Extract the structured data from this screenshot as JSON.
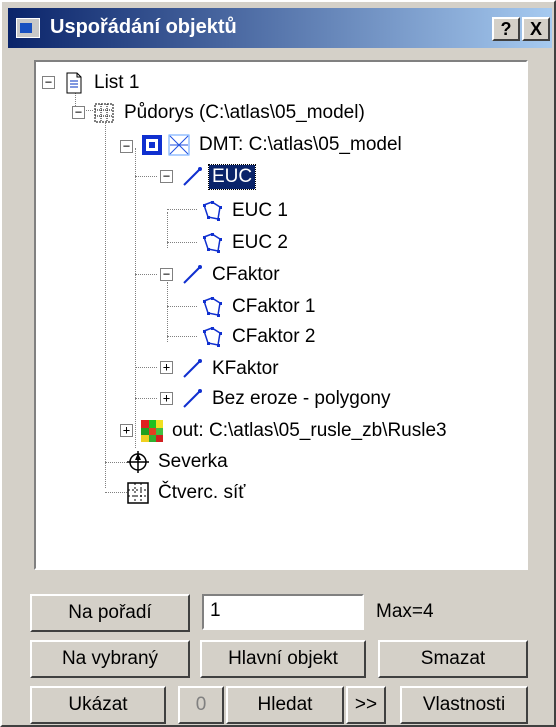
{
  "window": {
    "title": "Uspořádání objektů",
    "help_label": "?",
    "close_label": "X"
  },
  "tree": {
    "nodes": [
      {
        "label": "List 1",
        "icon": "document-icon",
        "expander": "−"
      },
      {
        "label": "Půdorys (C:\\atlas\\05_model)",
        "icon": "grid-layout-icon",
        "expander": "−"
      },
      {
        "label": "DMT: C:\\atlas\\05_model",
        "icon": "dmt-icon",
        "expander": "−"
      },
      {
        "label": "EUC",
        "icon": "line-icon",
        "expander": "−",
        "selected": true
      },
      {
        "label": "EUC 1",
        "icon": "polygon-icon"
      },
      {
        "label": "EUC 2",
        "icon": "polygon-icon"
      },
      {
        "label": "CFaktor",
        "icon": "line-icon",
        "expander": "−"
      },
      {
        "label": "CFaktor 1",
        "icon": "polygon-icon"
      },
      {
        "label": "CFaktor 2",
        "icon": "polygon-icon"
      },
      {
        "label": "KFaktor",
        "icon": "line-icon",
        "expander": "+"
      },
      {
        "label": "Bez eroze - polygony",
        "icon": "line-icon",
        "expander": "+"
      },
      {
        "label": "out: C:\\atlas\\05_rusle_zb\\Rusle3",
        "icon": "raster-icon",
        "expander": "+"
      },
      {
        "label": "Severka",
        "icon": "north-arrow-icon"
      },
      {
        "label": "Čtverc. síť",
        "icon": "grid-icon"
      }
    ]
  },
  "controls": {
    "na_poradi_label": "Na pořadí",
    "order_value": "1",
    "max_label": "Max=4",
    "na_vybrany_label": "Na vybraný",
    "hlavni_objekt_label": "Hlavní objekt",
    "smazat_label": "Smazat",
    "ukazat_label": "Ukázat",
    "zero_label": "0",
    "hledat_label": "Hledat",
    "next_label": ">>",
    "vlastnosti_label": "Vlastnosti"
  },
  "colors": {
    "title_start": "#0a246a",
    "title_end": "#a6caf0",
    "selection": "#0a246a",
    "face": "#d4d0c8"
  }
}
